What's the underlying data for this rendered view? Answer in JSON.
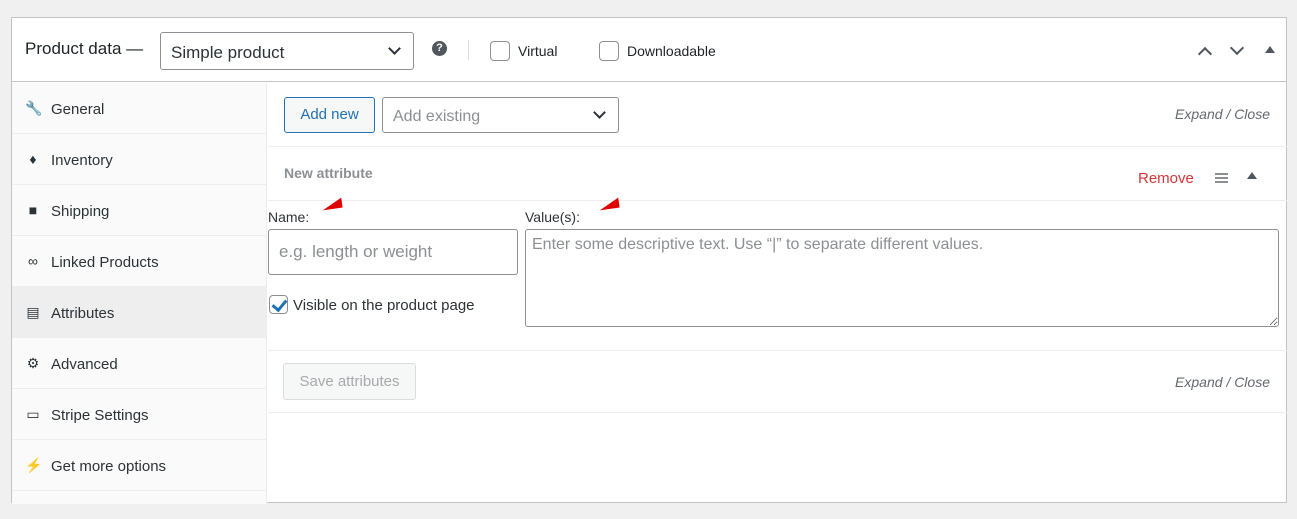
{
  "header": {
    "title": "Product data —",
    "product_type": "Simple product",
    "help_icon": "question-circle-icon",
    "virtual_label": "Virtual",
    "downloadable_label": "Downloadable"
  },
  "sidebar": {
    "items": [
      {
        "label": "General",
        "icon": "wrench-icon"
      },
      {
        "label": "Inventory",
        "icon": "tag-icon"
      },
      {
        "label": "Shipping",
        "icon": "truck-icon"
      },
      {
        "label": "Linked Products",
        "icon": "link-icon"
      },
      {
        "label": "Attributes",
        "icon": "list-icon",
        "active": true
      },
      {
        "label": "Advanced",
        "icon": "gear-icon"
      },
      {
        "label": "Stripe Settings",
        "icon": "window-icon"
      },
      {
        "label": "Get more options",
        "icon": "plug-icon"
      }
    ]
  },
  "toolbar": {
    "add_new_label": "Add new",
    "add_existing_placeholder": "Add existing",
    "expand_close": "Expand / Close"
  },
  "attribute": {
    "title": "New attribute",
    "remove_label": "Remove",
    "name_label": "Name:",
    "name_placeholder": "e.g. length or weight",
    "values_label": "Value(s):",
    "values_placeholder": "Enter some descriptive text. Use “|” to separate different values.",
    "visible_label": "Visible on the product page",
    "visible_checked": true
  },
  "footer": {
    "save_label": "Save attributes",
    "expand_close": "Expand / Close"
  },
  "colors": {
    "accent": "#2271b1",
    "remove": "#d63638",
    "annotation": "#e00000"
  }
}
